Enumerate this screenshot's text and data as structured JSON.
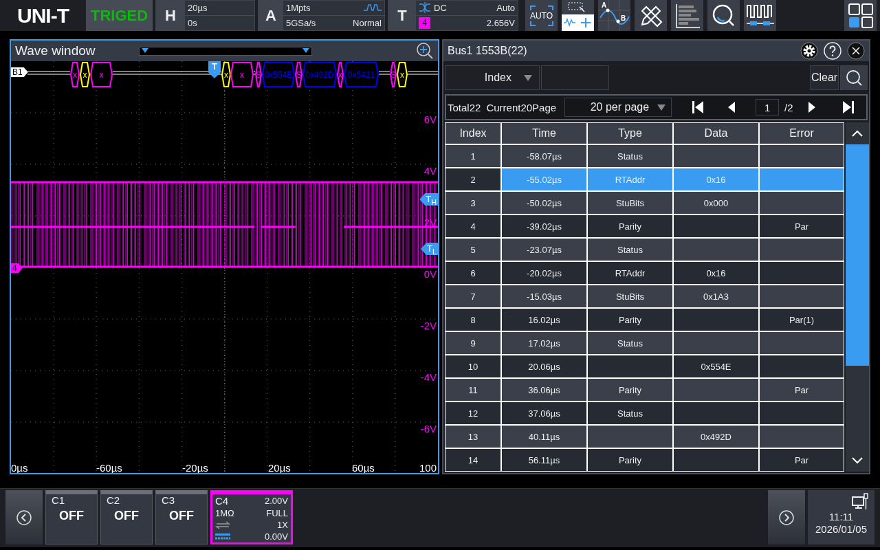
{
  "top_bar": {
    "logo": "UNI-T",
    "status": "TRIGED",
    "horizontal": {
      "label": "H",
      "scale": "20µs",
      "position": "0s"
    },
    "acquisition": {
      "label": "A",
      "depth": "1Mpts",
      "rate": "5GSa/s",
      "mode": "Normal"
    },
    "trigger": {
      "label": "T",
      "source": "4",
      "coupling": "DC",
      "sweep": "Auto",
      "level": "2.656V"
    },
    "auto_button": "AUTO",
    "cursor_labels": [
      "A",
      "B"
    ]
  },
  "wave_window": {
    "title": "Wave window",
    "selected": true,
    "bus_label": "B1",
    "channel_marker": "4",
    "trigger_marker": "T",
    "level_markers": [
      "T$_{H}$",
      "T$_{L}$"
    ],
    "volt_labels": [
      "6V",
      "4V",
      "2V",
      "0V",
      "-2V",
      "-4V",
      "-6V"
    ],
    "time_labels": [
      "0µs",
      "-60µs",
      "-20µs",
      "20µs",
      "60µs",
      "100"
    ],
    "bus_frames": [
      {
        "label": "x",
        "color": "#ff00ff"
      },
      {
        "label": "x",
        "color": "#ffff00"
      },
      {
        "label": "x",
        "color": "#ff00ff"
      },
      {
        "label": "x",
        "color": "#ffff00"
      },
      {
        "label": "x",
        "color": "#ff00ff"
      },
      {
        "label": "S",
        "color": "#ff00ff"
      },
      {
        "label": "0x554E",
        "color": "#0000ff"
      },
      {
        "label": "S",
        "color": "#ff00ff"
      },
      {
        "label": "0x492D",
        "color": "#0000ff"
      },
      {
        "label": "x",
        "color": "#ff00ff"
      },
      {
        "label": "0x5421",
        "color": "#0000ff"
      },
      {
        "label": "S",
        "color": "#ff00ff"
      },
      {
        "label": "x",
        "color": "#ffff00"
      }
    ]
  },
  "decode_panel": {
    "title": "Bus1 1553B(22)",
    "filter": {
      "column": "Index",
      "button": "Clear"
    },
    "pagination": {
      "total": "Total22",
      "current": "Current20Page",
      "per_page": "20 per page",
      "page": "1",
      "pages": "/2"
    },
    "columns": [
      "Index",
      "Time",
      "Type",
      "Data",
      "Error"
    ],
    "rows": [
      {
        "index": "1",
        "time": "-58.07µs",
        "type": "Status",
        "selected": false
      },
      {
        "index": "2",
        "time": "-55.02µs",
        "type": "RTAddr",
        "data": "0x16",
        "selected": true
      },
      {
        "index": "3",
        "time": "-50.02µs",
        "type": "StuBits",
        "data": "0x000",
        "selected": false
      },
      {
        "index": "4",
        "time": "-39.02µs",
        "type": "Parity",
        "error": "Par",
        "selected": false
      },
      {
        "index": "5",
        "time": "-23.07µs",
        "type": "Status",
        "selected": false
      },
      {
        "index": "6",
        "time": "-20.02µs",
        "type": "RTAddr",
        "data": "0x16",
        "selected": false
      },
      {
        "index": "7",
        "time": "-15.03µs",
        "type": "StuBits",
        "data": "0x1A3",
        "selected": false
      },
      {
        "index": "8",
        "time": "16.02µs",
        "type": "Parity",
        "error": "Par(1)",
        "selected": false
      },
      {
        "index": "9",
        "time": "17.02µs",
        "type": "Status",
        "selected": false
      },
      {
        "index": "10",
        "time": "20.06µs",
        "data": "0x554E",
        "selected": false
      },
      {
        "index": "11",
        "time": "36.06µs",
        "type": "Parity",
        "error": "Par",
        "selected": false
      },
      {
        "index": "12",
        "time": "37.06µs",
        "type": "Status",
        "selected": false
      },
      {
        "index": "13",
        "time": "40.11µs",
        "data": "0x492D",
        "selected": false
      },
      {
        "index": "14",
        "time": "56.11µs",
        "type": "Parity",
        "error": "Par",
        "selected": false
      }
    ]
  },
  "bottom_bar": {
    "channels": [
      {
        "label": "C1",
        "on": false,
        "status": "OFF"
      },
      {
        "label": "C2",
        "on": false,
        "status": "OFF"
      },
      {
        "label": "C3",
        "on": false,
        "status": "OFF"
      },
      {
        "label": "C4",
        "on": true,
        "color": "#ff00ff",
        "scale": "2.00V",
        "impedance": "1MΩ",
        "bandwidth": "FULL",
        "probe": "1X",
        "offset": "0.00V"
      }
    ],
    "time": "11:11",
    "date": "2026/01/05"
  }
}
